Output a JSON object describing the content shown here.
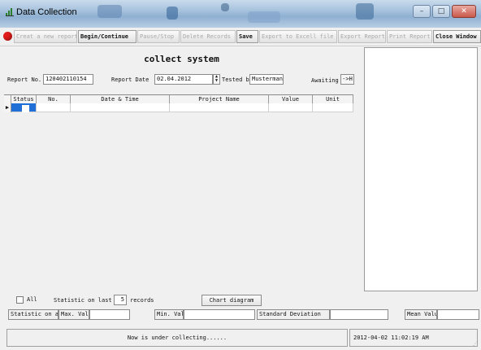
{
  "window": {
    "title": "Data Collection",
    "controls": {
      "minimize": "–",
      "maximize": "□",
      "close": "✕"
    }
  },
  "toolbar": {
    "record_indicator_color": "#e21b1b",
    "buttons": [
      {
        "label": "Creat a new report",
        "enabled": false
      },
      {
        "label": "Begin/Continue",
        "enabled": true
      },
      {
        "label": "Pause/Stop",
        "enabled": false
      },
      {
        "label": "Delete Records",
        "enabled": false
      },
      {
        "label": "Save",
        "enabled": true
      },
      {
        "label": "Export to Excell file",
        "enabled": false
      },
      {
        "label": "Export Report",
        "enabled": false
      },
      {
        "label": "Print Report",
        "enabled": false
      },
      {
        "label": "Close Window",
        "enabled": true
      }
    ]
  },
  "main": {
    "heading": "collect system",
    "report_no_label": "Report No.",
    "report_no_value": "120402110154",
    "report_date_label": "Report Date",
    "report_date_value": "02.04.2012",
    "tested_by_label": "Tested by",
    "tested_by_value": "Mustermann",
    "awaiting_label": "Awaiting",
    "awaiting_button": "->H"
  },
  "grid": {
    "columns": [
      "Status",
      "No.",
      "Date & Time",
      "Project Name",
      "Value",
      "Unit"
    ],
    "row_pointer": "▶"
  },
  "stats": {
    "all_label": "All",
    "statistic_on_last_label": "Statistic on last",
    "records_count": "5",
    "records_label": "records",
    "chart_button": "Chart diagram",
    "statistic_on_all_label": "Statistic on all",
    "max_label": "Max. Value",
    "min_label": "Min. Value",
    "std_label": "Standard Deviation",
    "mean_label": "Mean Value"
  },
  "statusbar": {
    "message": "Now is under collecting......",
    "datetime": "2012-04-02 11:02:19 AM"
  },
  "colors": {
    "titlebar": "#a9c4de",
    "selection": "#1f6fd6",
    "record_dot": "#e21b1b"
  }
}
